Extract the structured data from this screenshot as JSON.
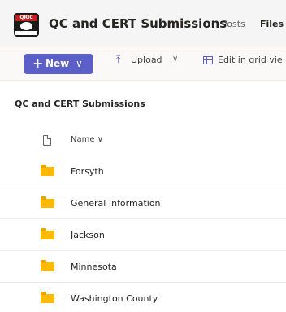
{
  "header": {
    "logo_text": "QRIC",
    "team_title": "QC and CERT Submissions",
    "tabs": [
      {
        "label": "Posts"
      },
      {
        "label": "Files"
      }
    ]
  },
  "toolbar": {
    "new_label": "New",
    "upload_label": "Upload",
    "grid_label": "Edit in grid vie"
  },
  "breadcrumb": "QC and CERT Submissions",
  "table": {
    "name_header": "Name",
    "rows": [
      {
        "name": "Forsyth"
      },
      {
        "name": "General Information"
      },
      {
        "name": "Jackson"
      },
      {
        "name": "Minnesota"
      },
      {
        "name": "Washington County"
      }
    ]
  },
  "colors": {
    "accent": "#5b5fc7",
    "folder": "#ffb900",
    "logo_red": "#c0221f"
  }
}
